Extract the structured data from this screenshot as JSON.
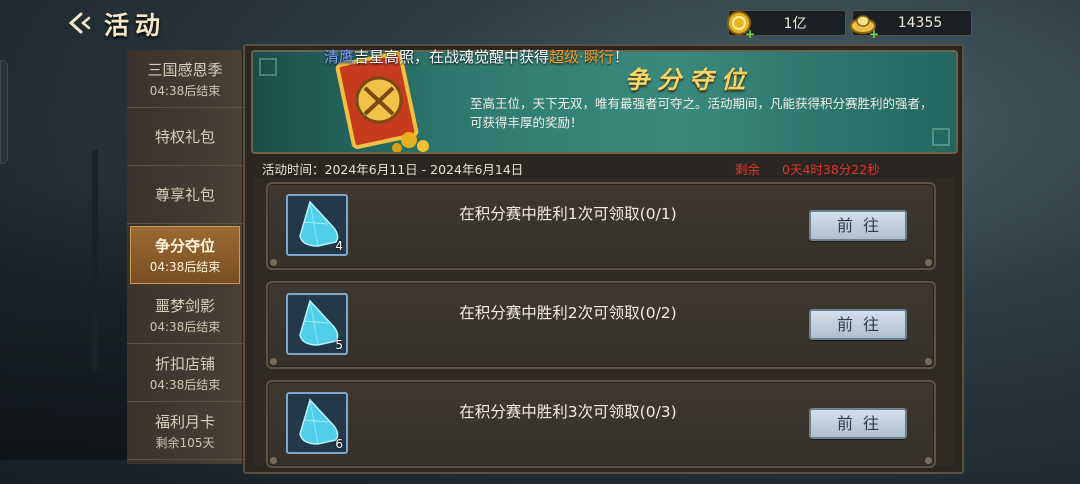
{
  "header": {
    "title": "活动",
    "resources": [
      {
        "icon": "gold-coin-icon",
        "value": "1亿"
      },
      {
        "icon": "silver-ingot-icon",
        "value": "14355"
      }
    ]
  },
  "sidebar": {
    "items": [
      {
        "label": "三国感恩季",
        "sub": "04:38后结束"
      },
      {
        "label": "特权礼包",
        "sub": ""
      },
      {
        "label": "尊享礼包",
        "sub": ""
      },
      {
        "label": "争分夺位",
        "sub": "04:38后结束"
      },
      {
        "label": "噩梦剑影",
        "sub": "04:38后结束"
      },
      {
        "label": "折扣店铺",
        "sub": "04:38后结束"
      },
      {
        "label": "福利月卡",
        "sub": "剩余105天"
      }
    ]
  },
  "ticker": {
    "name": "清鹰",
    "part1": "吉星高照，在战魂觉醒中获得",
    "highlight": "超级·瞬行",
    "part2": "！"
  },
  "banner": {
    "title": "争分夺位",
    "description": "至高王位，天下无双，唯有最强者可夺之。活动期间，凡能获得积分赛胜利的强者，可获得丰厚的奖励！"
  },
  "event": {
    "time_label": "活动时间：2024年6月11日 - 2024年6月14日",
    "remain_label": "剩余",
    "remain_value": "0天4时38分22秒"
  },
  "tasks": [
    {
      "text": "在积分赛中胜利1次可领取(0/1)",
      "reward_count": "4",
      "button": "前往"
    },
    {
      "text": "在积分赛中胜利2次可领取(0/2)",
      "reward_count": "5",
      "button": "前往"
    },
    {
      "text": "在积分赛中胜利3次可领取(0/3)",
      "reward_count": "6",
      "button": "前往"
    }
  ],
  "colors": {
    "accent_gold": "#f6d568",
    "active_tab": "#9b6a34",
    "countdown_red": "#e2322a",
    "ticker_name": "#7fa4ff",
    "ticker_highlight": "#ff9c2a"
  }
}
